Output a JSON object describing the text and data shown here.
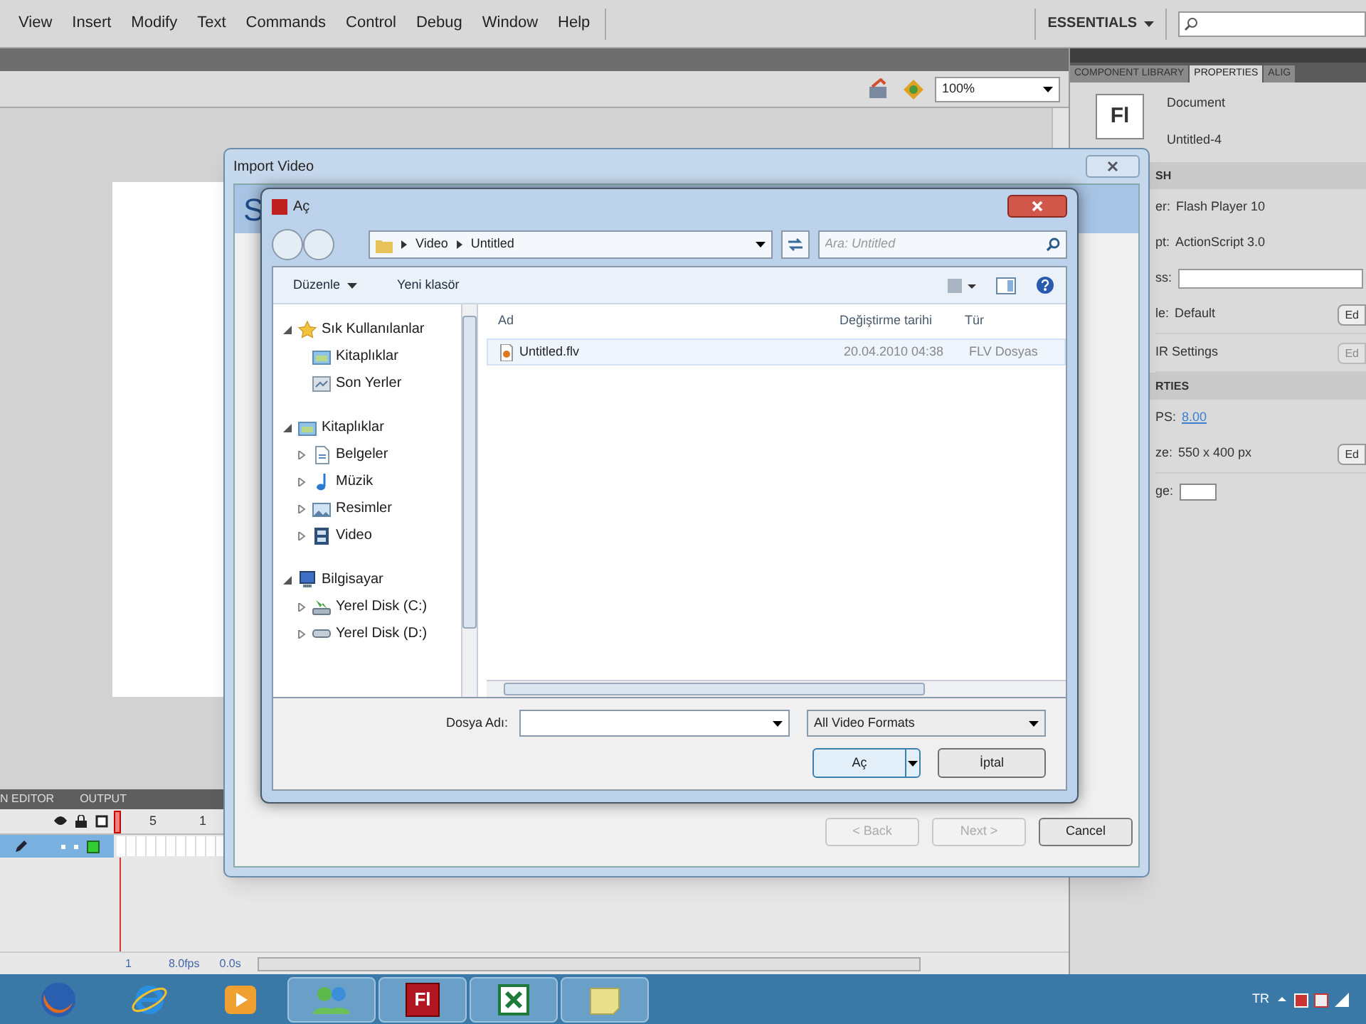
{
  "menu": [
    "View",
    "Insert",
    "Modify",
    "Text",
    "Commands",
    "Control",
    "Debug",
    "Window",
    "Help"
  ],
  "workspace": "ESSENTIALS",
  "zoom": "100%",
  "timeline": {
    "tabs": [
      "N EDITOR",
      "OUTPUT"
    ],
    "frame_numbers": [
      "5",
      "1"
    ],
    "status": [
      "1",
      "8.0fps",
      "0.0s"
    ]
  },
  "properties_panel": {
    "tabs": [
      {
        "label": "COMPONENT LIBRARY",
        "selected": false
      },
      {
        "label": "PROPERTIES",
        "selected": true
      },
      {
        "label": "ALIG",
        "selected": false
      }
    ],
    "logo": "Fl",
    "type": "Document",
    "name": "Untitled-4",
    "rows": [
      {
        "kind": "section",
        "label": "SH"
      },
      {
        "kind": "text",
        "label": "er:",
        "value": "Flash Player 10"
      },
      {
        "kind": "text",
        "label": "pt:",
        "value": "ActionScript 3.0"
      },
      {
        "kind": "field",
        "label": "ss:"
      },
      {
        "kind": "button",
        "label": "le:",
        "value": "Default",
        "button": "Ed",
        "disabled": false
      },
      {
        "kind": "button",
        "label": "IR Settings",
        "button": "Ed",
        "disabled": true
      },
      {
        "kind": "section",
        "label": "RTIES"
      },
      {
        "kind": "link",
        "label": "PS:",
        "value": "8.00"
      },
      {
        "kind": "button",
        "label": "ze:",
        "value": "550 x 400 px",
        "button": "Ed",
        "disabled": false
      },
      {
        "kind": "swatch",
        "label": "ge:"
      }
    ]
  },
  "import_dialog": {
    "title": "Import Video",
    "heading": "S",
    "buttons": [
      {
        "label": "< Back",
        "disabled": true
      },
      {
        "label": "Next >",
        "disabled": true
      },
      {
        "label": "Cancel",
        "disabled": false
      }
    ]
  },
  "open_dialog": {
    "title": "Aç",
    "path": [
      "Video",
      "Untitled"
    ],
    "search_placeholder": "Ara: Untitled",
    "toolbar": [
      {
        "label": "Düzenle",
        "menu": true
      },
      {
        "label": "Yeni klasör",
        "menu": false
      }
    ],
    "tree": [
      {
        "label": "Sık Kullanılanlar",
        "kind": "star",
        "expanded": true,
        "children": [
          {
            "label": "Kitaplıklar",
            "kind": "library"
          },
          {
            "label": "Son Yerler",
            "kind": "recent"
          }
        ]
      },
      {
        "label": "Kitaplıklar",
        "kind": "library",
        "expanded": true,
        "children": [
          {
            "label": "Belgeler",
            "kind": "document",
            "expanded": false
          },
          {
            "label": "Müzik",
            "kind": "music",
            "expanded": false
          },
          {
            "label": "Resimler",
            "kind": "picture",
            "expanded": false
          },
          {
            "label": "Video",
            "kind": "video",
            "expanded": false
          }
        ]
      },
      {
        "label": "Bilgisayar",
        "kind": "computer",
        "expanded": true,
        "children": [
          {
            "label": "Yerel Disk (C:)",
            "kind": "disk",
            "expanded": false
          },
          {
            "label": "Yerel Disk (D:)",
            "kind": "drive",
            "expanded": false
          }
        ]
      }
    ],
    "columns": [
      "Ad",
      "Değiştirme tarihi",
      "Tür"
    ],
    "files": [
      {
        "name": "Untitled.flv",
        "modified": "20.04.2010 04:38",
        "type": "FLV Dosyas",
        "selected": true
      }
    ],
    "filename_label": "Dosya Adı:",
    "filter": "All Video Formats",
    "buttons": [
      "Aç",
      "İptal"
    ]
  },
  "taskbar": {
    "apps": [
      {
        "kind": "firefox",
        "running": false
      },
      {
        "kind": "browser",
        "running": false
      },
      {
        "kind": "media",
        "running": false
      },
      {
        "kind": "people",
        "running": true
      },
      {
        "kind": "flash",
        "label": "Fl",
        "running": true
      },
      {
        "kind": "sheet",
        "running": true
      },
      {
        "kind": "notes",
        "running": true
      }
    ],
    "language": "TR"
  }
}
